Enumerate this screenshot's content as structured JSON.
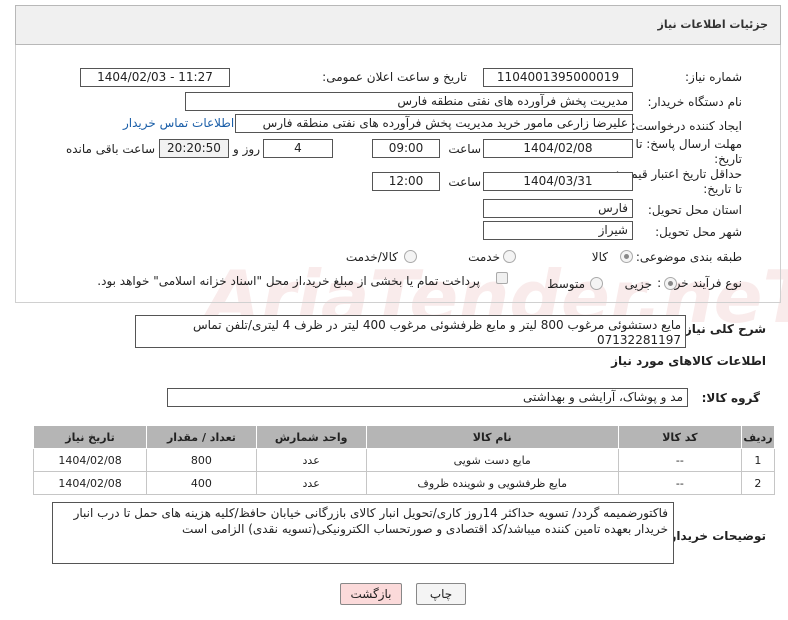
{
  "header": {
    "title": "جزئیات اطلاعات نیاز"
  },
  "fields": {
    "need_number_label": "شماره نیاز:",
    "need_number": "1104001395000019",
    "announce_label": "تاریخ و ساعت اعلان عمومی:",
    "announce_value": "1404/02/03 - 11:27",
    "buyer_org_label": "نام دستگاه خریدار:",
    "buyer_org": "مدیریت پخش فرآورده های نفتی منطقه فارس",
    "creator_label": "ایجاد کننده درخواست:",
    "creator": "علیرضا زارعی مامور خرید مدیریت پخش فرآورده های نفتی منطقه فارس",
    "buyer_contact_link": "اطلاعات تماس خریدار",
    "deadline_label": "مهلت ارسال پاسخ: تا تاریخ:",
    "deadline_date": "1404/02/08",
    "time_label": "ساعت",
    "deadline_time": "09:00",
    "days_value": "4",
    "days_label": "روز و",
    "remaining_time": "20:20:50",
    "remaining_label": "ساعت باقی مانده",
    "validity_label": "حداقل تاریخ اعتبار قیمت: تا تاریخ:",
    "validity_date": "1404/03/31",
    "validity_time": "12:00",
    "province_label": "استان محل تحویل:",
    "province": "فارس",
    "city_label": "شهر محل تحویل:",
    "city": "شیراز",
    "category_label": "طبقه بندی موضوعی:",
    "category_options": [
      "کالا",
      "خدمت",
      "کالا/خدمت"
    ],
    "process_label": "نوع فرآیند خرید :",
    "process_options": [
      "جزیی",
      "متوسط"
    ],
    "payment_note": "پرداخت تمام یا بخشی از مبلغ خرید،از محل \"اسناد خزانه اسلامی\" خواهد بود."
  },
  "description": {
    "label": "شرح کلی نیاز:",
    "text": "مایع دستشوئی مرغوب 800 لیتر و مایع ظرفشوئی مرغوب 400 لیتر در ظرف 4 لیتری/تلفن تماس 07132281197"
  },
  "goods": {
    "section_title": "اطلاعات کالاهای مورد نیاز",
    "group_label": "گروه کالا:",
    "group_value": "مد و پوشاک، آرایشی و بهداشتی",
    "columns": [
      "ردیف",
      "کد کالا",
      "نام کالا",
      "واحد شمارش",
      "تعداد / مقدار",
      "تاریخ نیاز"
    ],
    "rows": [
      [
        "1",
        "--",
        "مایع دست شویی",
        "عدد",
        "800",
        "1404/02/08"
      ],
      [
        "2",
        "--",
        "مایع ظرفشویی و شوینده ظروف",
        "عدد",
        "400",
        "1404/02/08"
      ]
    ]
  },
  "buyer_notes": {
    "label": "توضیحات خریدار:",
    "text": "فاکتورضمیمه گردد/ تسویه حداکثر 14روز کاری/تحویل انبار کالای بازرگانی خیابان حافظ/کلیه هزینه های حمل تا درب انبار خریدار بعهده تامین کننده میباشد/کد اقتصادی و صورتحساب الکترونیکی(تسویه نقدی) الزامی است"
  },
  "buttons": {
    "print": "چاپ",
    "back": "بازگشت"
  },
  "colors": {
    "header_bg": "#f0f0f0",
    "table_header_bg": "#b5b5b5",
    "link": "#1a5ea8",
    "back_button_bg": "#fbdada"
  }
}
